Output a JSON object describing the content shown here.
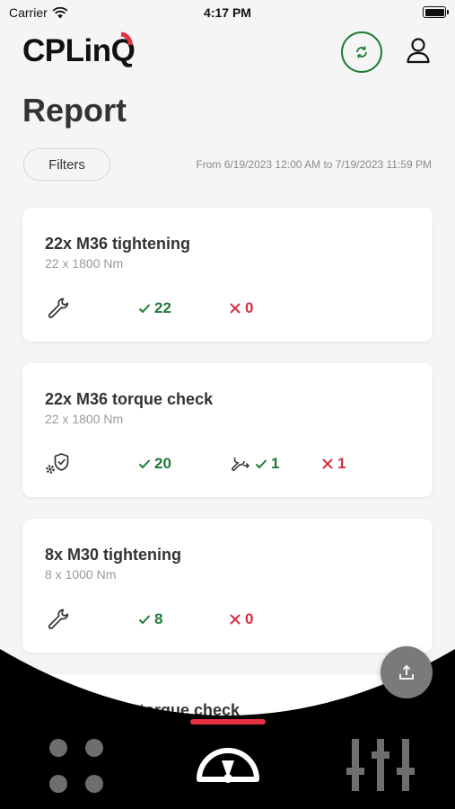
{
  "status_bar": {
    "carrier": "Carrier",
    "time": "4:17 PM"
  },
  "header": {
    "logo_text": "CPLinQ"
  },
  "page": {
    "title": "Report",
    "filters_label": "Filters",
    "date_range": "From 6/19/2023 12:00 AM to 7/19/2023 11:59 PM"
  },
  "cards": [
    {
      "title": "22x M36 tightening",
      "subtitle": "22 x  1800 Nm",
      "type_icon": "wrench-icon",
      "ok": "22",
      "nok": "0"
    },
    {
      "title": "22x M36 torque check",
      "subtitle": "22 x  1800 Nm",
      "type_icon": "gear-shield-icon",
      "ok": "20",
      "partial": "1",
      "nok": "1"
    },
    {
      "title": "8x M30 tightening",
      "subtitle": "8 x  1000 Nm",
      "type_icon": "wrench-icon",
      "ok": "8",
      "nok": "0"
    },
    {
      "title": "torque check"
    }
  ],
  "colors": {
    "ok": "#1e7a36",
    "nok": "#d32f3f",
    "accent": "#e3313f",
    "nav_bg": "#000000"
  },
  "bottom_nav": [
    {
      "icon": "dashboard-grid-icon"
    },
    {
      "icon": "gauge-icon",
      "active": true
    },
    {
      "icon": "sliders-icon"
    }
  ]
}
